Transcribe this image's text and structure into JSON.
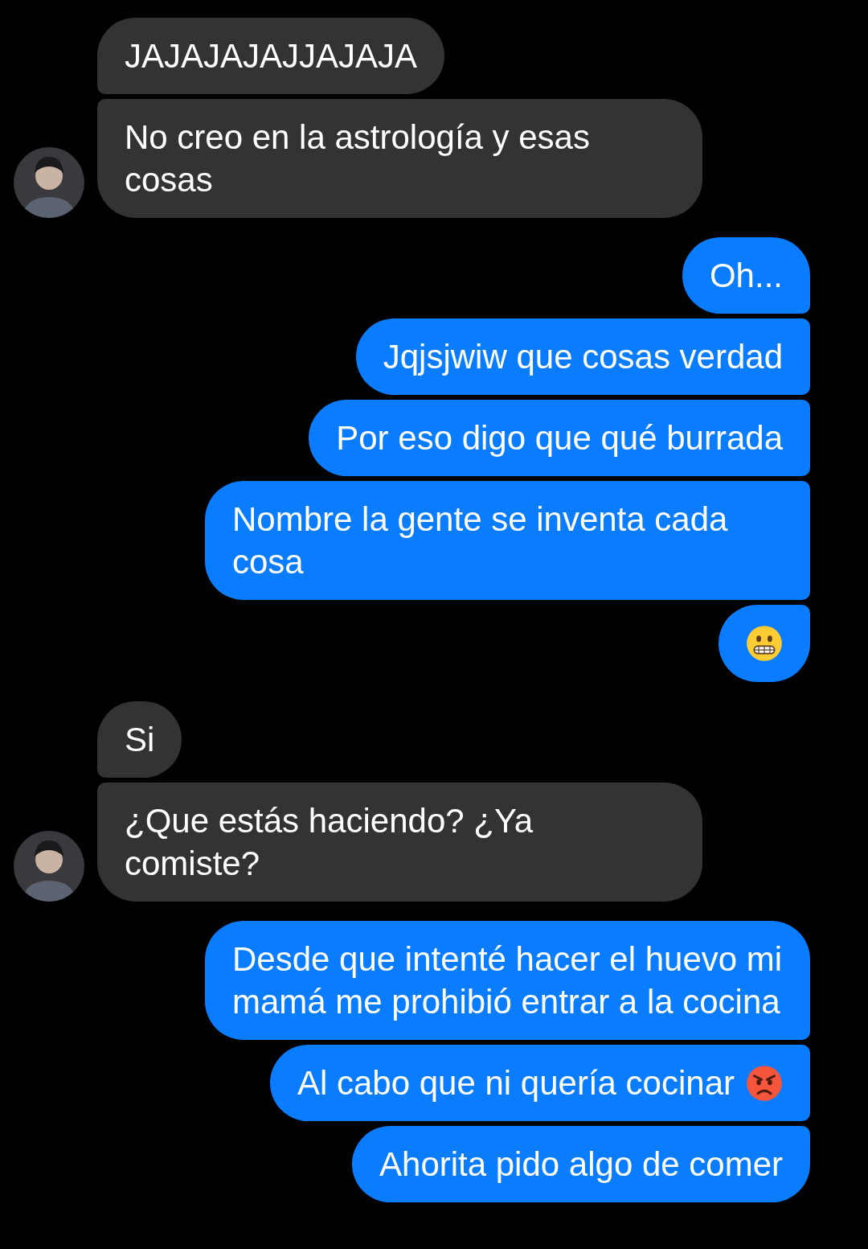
{
  "groups": [
    {
      "outgoing": false,
      "messages": [
        {
          "kind": "text",
          "text": "JAJAJAJAJJAJAJA"
        },
        {
          "kind": "text",
          "text": "No creo en la astrología y esas cosas"
        }
      ]
    },
    {
      "outgoing": true,
      "messages": [
        {
          "kind": "text",
          "text": "Oh..."
        },
        {
          "kind": "text",
          "text": "Jqjsjwiw que cosas verdad"
        },
        {
          "kind": "text",
          "text": "Por eso digo que qué burrada"
        },
        {
          "kind": "text",
          "text": "Nombre la gente se inventa cada cosa"
        },
        {
          "kind": "grimacing"
        }
      ]
    },
    {
      "outgoing": false,
      "messages": [
        {
          "kind": "text",
          "text": "Si"
        },
        {
          "kind": "text",
          "text": "¿Que estás haciendo? ¿Ya comiste?"
        }
      ]
    },
    {
      "outgoing": true,
      "messages": [
        {
          "kind": "text",
          "text": "Desde que intenté hacer el huevo mi mamá me prohibió entrar a la cocina"
        },
        {
          "kind": "text",
          "text": "Al cabo que ni quería cocinar",
          "angry": true
        },
        {
          "kind": "text",
          "text": "Ahorita pido algo de comer"
        }
      ]
    }
  ]
}
